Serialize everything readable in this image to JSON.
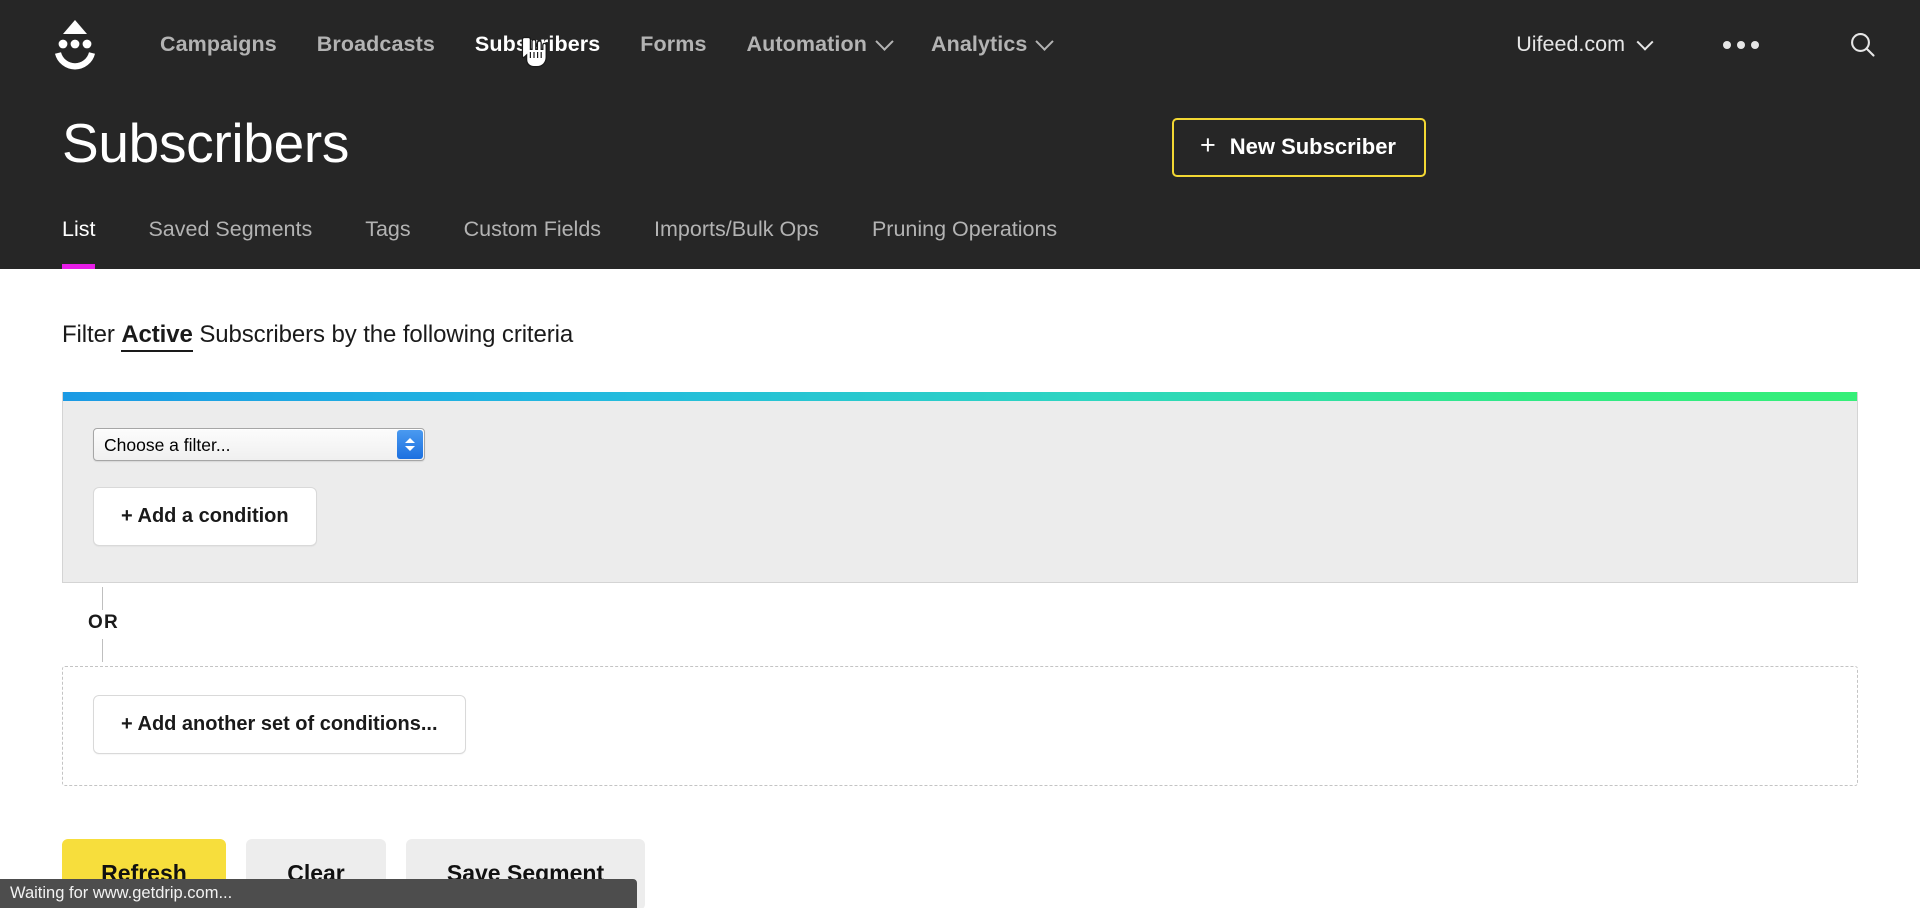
{
  "nav": {
    "logo_icon": "drip-smiley-logo",
    "links": [
      {
        "label": "Campaigns",
        "has_caret": false,
        "active": false
      },
      {
        "label": "Broadcasts",
        "has_caret": false,
        "active": false
      },
      {
        "label": "Subscribers",
        "has_caret": false,
        "active": true
      },
      {
        "label": "Forms",
        "has_caret": false,
        "active": false
      },
      {
        "label": "Automation",
        "has_caret": true,
        "active": false
      },
      {
        "label": "Analytics",
        "has_caret": true,
        "active": false
      }
    ],
    "account_label": "Uifeed.com",
    "overflow_icon": "ellipsis-icon",
    "search_icon": "search-icon"
  },
  "header": {
    "title": "Subscribers",
    "new_subscriber_button": "New Subscriber",
    "new_subscriber_plus": "+",
    "accent_border_color": "#f2d733"
  },
  "tabs": {
    "active_underline_color": "#e81ce8",
    "items": [
      {
        "label": "List",
        "active": true
      },
      {
        "label": "Saved Segments",
        "active": false
      },
      {
        "label": "Tags",
        "active": false
      },
      {
        "label": "Custom Fields",
        "active": false
      },
      {
        "label": "Imports/Bulk Ops",
        "active": false
      },
      {
        "label": "Pruning Operations",
        "active": false
      }
    ]
  },
  "filter": {
    "prefix": "Filter",
    "status_link": "Active",
    "suffix": "Subscribers by the following criteria",
    "gradient_colors": [
      "#1b9ae4",
      "#22b8e0",
      "#2ed6c0",
      "#31e985",
      "#35ef78"
    ],
    "select_value": "Choose a filter...",
    "select_options": [
      "Choose a filter..."
    ],
    "add_condition_button": "+ Add a condition",
    "or_label": "OR",
    "add_another_set_button": "+ Add another set of conditions..."
  },
  "actions": {
    "refresh": "Refresh",
    "clear": "Clear",
    "save_segment": "Save Segment",
    "refresh_color": "#f7de3c"
  },
  "statusbar": {
    "text": "Waiting for www.getdrip.com..."
  }
}
